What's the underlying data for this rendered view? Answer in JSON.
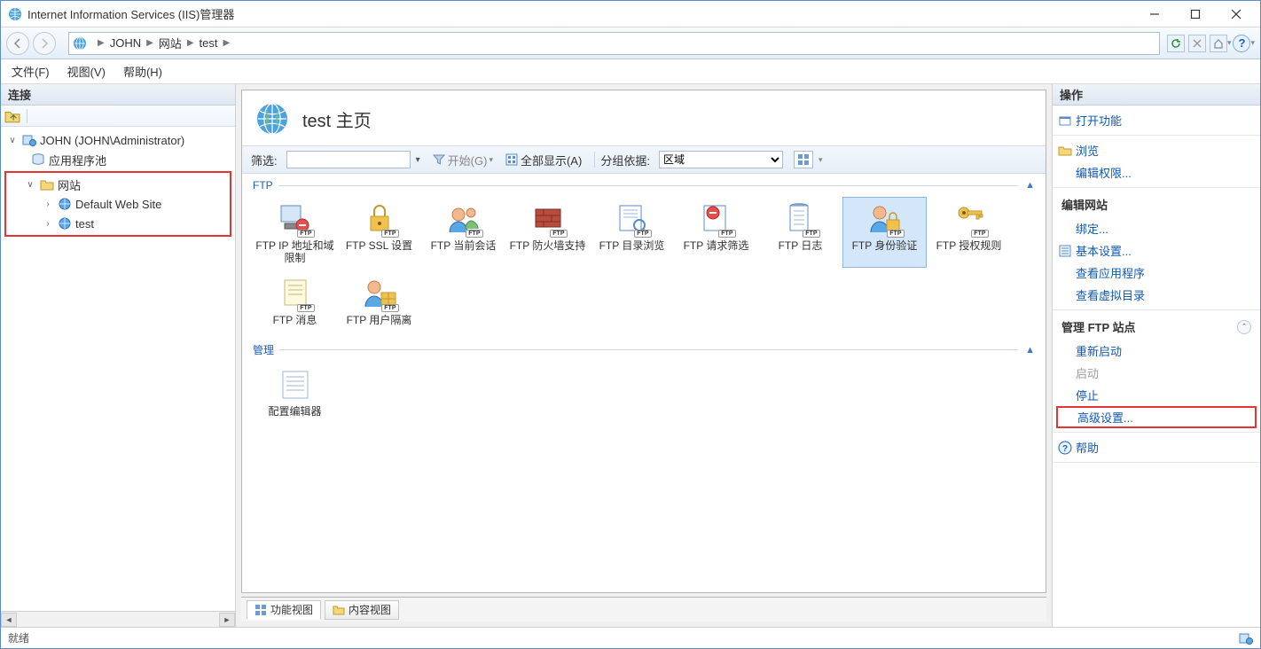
{
  "window": {
    "title": "Internet Information Services (IIS)管理器"
  },
  "breadcrumb": {
    "items": [
      "JOHN",
      "网站",
      "test"
    ]
  },
  "menubar": {
    "file": "文件(F)",
    "view": "视图(V)",
    "help": "帮助(H)"
  },
  "connections": {
    "header": "连接",
    "tree": {
      "server": "JOHN (JOHN\\Administrator)",
      "app_pools": "应用程序池",
      "sites": "网站",
      "site_default": "Default Web Site",
      "site_test": "test"
    }
  },
  "page": {
    "title": "test 主页",
    "filter_label": "筛选:",
    "start_label": "开始(G)",
    "show_all_label": "全部显示(A)",
    "group_by_label": "分组依据:",
    "group_by_value": "区域"
  },
  "groups": {
    "ftp": {
      "title": "FTP",
      "items": [
        "FTP IP 地址和域限制",
        "FTP SSL 设置",
        "FTP 当前会话",
        "FTP 防火墙支持",
        "FTP 目录浏览",
        "FTP 请求筛选",
        "FTP 日志",
        "FTP 身份验证",
        "FTP 授权规则",
        "FTP 消息",
        "FTP 用户隔离"
      ],
      "selected_index": 7
    },
    "mgmt": {
      "title": "管理",
      "items": [
        "配置编辑器"
      ]
    }
  },
  "view_tabs": {
    "features": "功能视图",
    "content": "内容视图"
  },
  "actions": {
    "header": "操作",
    "open_feature": "打开功能",
    "explore": "浏览",
    "edit_permissions": "编辑权限...",
    "edit_site_header": "编辑网站",
    "bindings": "绑定...",
    "basic_settings": "基本设置...",
    "view_apps": "查看应用程序",
    "view_vdirs": "查看虚拟目录",
    "manage_ftp_header": "管理 FTP 站点",
    "restart": "重新启动",
    "start": "启动",
    "stop": "停止",
    "advanced": "高级设置...",
    "help": "帮助"
  },
  "status": {
    "ready": "就绪"
  }
}
